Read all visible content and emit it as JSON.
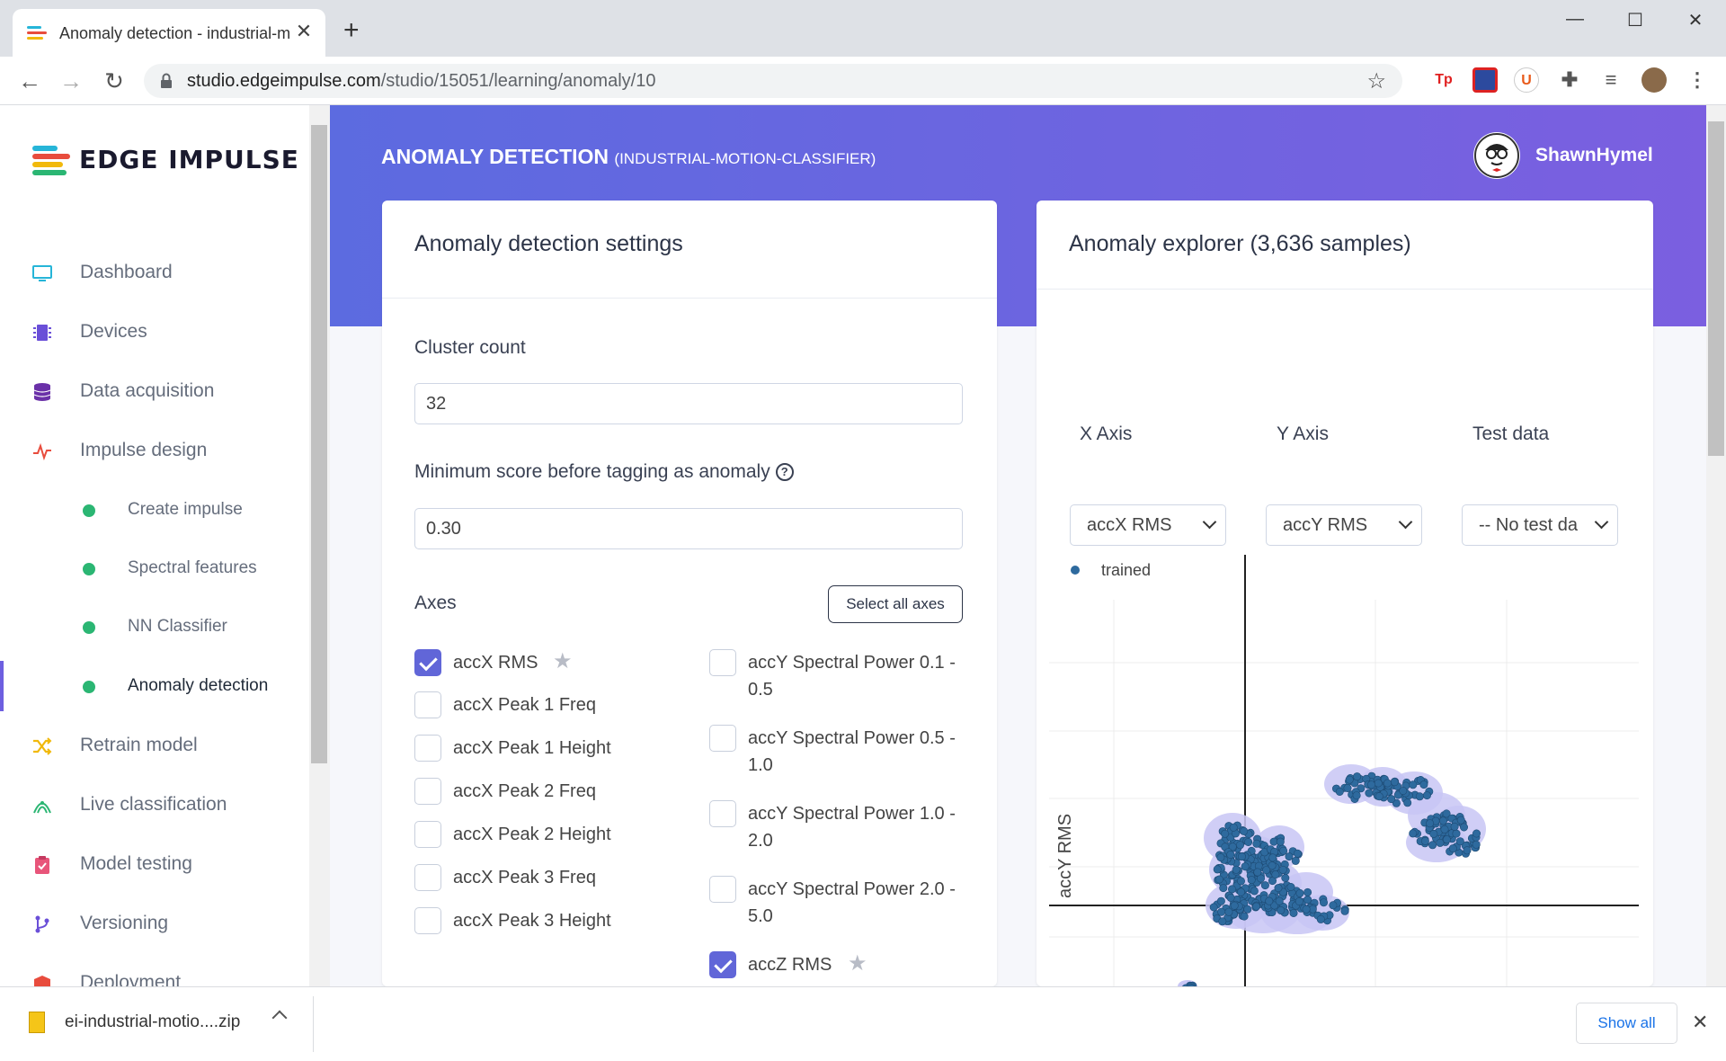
{
  "browser": {
    "tab_title": "Anomaly detection - industrial-m",
    "tab_close": "✕",
    "new_tab": "+",
    "url_host": "studio.edgeimpulse.com",
    "url_path": "/studio/15051/learning/anomaly/10",
    "window_controls": [
      "—",
      "☐",
      "✕"
    ],
    "extensions": [
      "Tp",
      "U"
    ]
  },
  "sidebar": {
    "logo": "EDGE IMPULSE",
    "items": [
      {
        "label": "Dashboard",
        "icon": "monitor-icon",
        "color": "#26b5d8"
      },
      {
        "label": "Devices",
        "icon": "chip-icon",
        "color": "#6a4fd8"
      },
      {
        "label": "Data acquisition",
        "icon": "database-icon",
        "color": "#6a30a8"
      },
      {
        "label": "Impulse design",
        "icon": "pulse-icon",
        "color": "#e84c3d"
      }
    ],
    "sub_items": [
      {
        "label": "Create impulse"
      },
      {
        "label": "Spectral features"
      },
      {
        "label": "NN Classifier"
      },
      {
        "label": "Anomaly detection",
        "active": true
      }
    ],
    "lower_items": [
      {
        "label": "Retrain model",
        "icon": "shuffle-icon",
        "color": "#f1b90c"
      },
      {
        "label": "Live classification",
        "icon": "radar-icon",
        "color": "#2bb673"
      },
      {
        "label": "Model testing",
        "icon": "clipboard-icon",
        "color": "#e8557a"
      },
      {
        "label": "Versioning",
        "icon": "branch-icon",
        "color": "#6a4fd8"
      },
      {
        "label": "Deployment",
        "icon": "box-icon",
        "color": "#e84c3d"
      }
    ]
  },
  "header": {
    "title": "ANOMALY DETECTION",
    "subtitle": "(INDUSTRIAL-MOTION-CLASSIFIER)",
    "user": "ShawnHymel",
    "accent": "#6a66e0"
  },
  "settings": {
    "title": "Anomaly detection settings",
    "cluster_label": "Cluster count",
    "cluster_value": "32",
    "min_score_label": "Minimum score before tagging as anomaly",
    "min_score_value": "0.30",
    "help": "?",
    "axes_label": "Axes",
    "select_all": "Select all axes",
    "axes_left": [
      {
        "label": "accX RMS",
        "checked": true,
        "starred": true
      },
      {
        "label": "accX Peak 1 Freq",
        "checked": false
      },
      {
        "label": "accX Peak 1 Height",
        "checked": false
      },
      {
        "label": "accX Peak 2 Freq",
        "checked": false
      },
      {
        "label": "accX Peak 2 Height",
        "checked": false
      },
      {
        "label": "accX Peak 3 Freq",
        "checked": false
      },
      {
        "label": "accX Peak 3 Height",
        "checked": false
      }
    ],
    "axes_right": [
      {
        "line1": "accY Spectral Power 0.1 -",
        "line2": "0.5",
        "checked": false
      },
      {
        "line1": "accY Spectral Power 0.5 -",
        "line2": "1.0",
        "checked": false
      },
      {
        "line1": "accY Spectral Power 1.0 -",
        "line2": "2.0",
        "checked": false
      },
      {
        "line1": "accY Spectral Power 2.0 -",
        "line2": "5.0",
        "checked": false
      },
      {
        "line1": "accZ RMS",
        "line2": "",
        "checked": true,
        "starred": true
      }
    ]
  },
  "explorer": {
    "title": "Anomaly explorer (3,636 samples)",
    "x_axis_label": "X Axis",
    "y_axis_label": "Y Axis",
    "test_label": "Test data",
    "x_value": "accX RMS",
    "y_value": "accY RMS",
    "test_value": "-- No test da"
  },
  "chart_data": {
    "type": "scatter",
    "series": [
      {
        "name": "trained",
        "color": "#2e6a9e"
      }
    ],
    "xlabel": "accX RMS",
    "ylabel": "accY RMS",
    "cluster_color": "#c8c6f5",
    "grid": true,
    "legend": "top-left"
  },
  "downloads": {
    "file": "ei-industrial-motio....zip",
    "show_all": "Show all",
    "close": "✕"
  }
}
